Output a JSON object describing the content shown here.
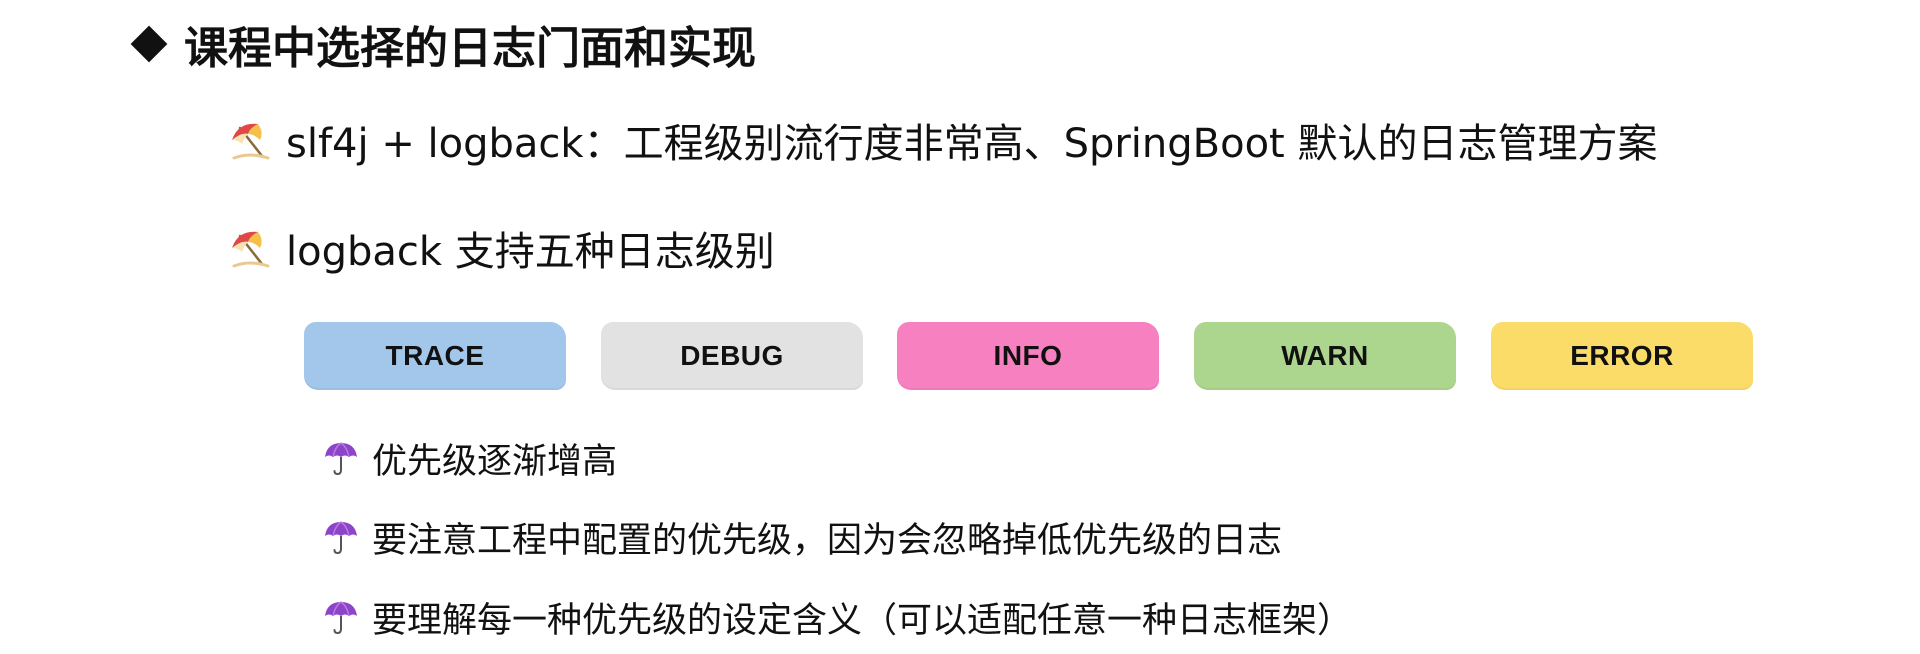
{
  "title": "课程中选择的日志门面和实现",
  "bullets": [
    {
      "icon": "beach-umbrella-icon",
      "text": "slf4j + logback：工程级别流行度非常高、SpringBoot 默认的日志管理方案"
    },
    {
      "icon": "beach-umbrella-icon",
      "text": "logback 支持五种日志级别"
    }
  ],
  "levels": [
    {
      "label": "TRACE",
      "color": "#a3c6eb"
    },
    {
      "label": "DEBUG",
      "color": "#e2e2e2"
    },
    {
      "label": "INFO",
      "color": "#f780c0"
    },
    {
      "label": "WARN",
      "color": "#acd68e"
    },
    {
      "label": "ERROR",
      "color": "#fcdc68"
    }
  ],
  "sub_bullets": [
    {
      "icon": "umbrella-icon",
      "text": "优先级逐渐增高"
    },
    {
      "icon": "umbrella-icon",
      "text": "要注意工程中配置的优先级，因为会忽略掉低优先级的日志"
    },
    {
      "icon": "umbrella-icon",
      "text": "要理解每一种优先级的设定含义（可以适配任意一种日志框架）"
    }
  ]
}
